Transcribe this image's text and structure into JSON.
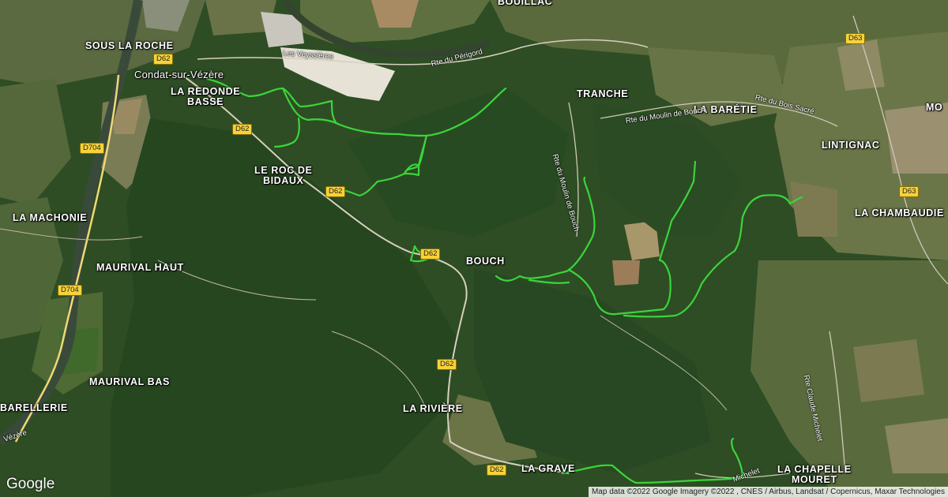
{
  "map": {
    "logo": "Google",
    "attribution": "Map data ©2022 Google Imagery ©2022 , CNES / Airbus, Landsat / Copernicus, Maxar Technologies",
    "route_color": "#3bd53b",
    "road_color": "#c9c2b5",
    "shield_color": "#f7d23a"
  },
  "places": {
    "sous_la_roche": "SOUS LA ROCHE",
    "condat": "Condat-sur-Vézère",
    "la_redonde_basse": "LA REDONDE\nBASSE",
    "le_roc_de_bidaux": "LE ROC DE\nBIDAUX",
    "la_machonie": "LA MACHONIE",
    "maurival_haut": "MAURIVAL HAUT",
    "maurival_bas": "MAURIVAL BAS",
    "barellerie": "BARELLERIE",
    "la_riviere": "LA RIVIÈRE",
    "la_grave": "LA GRAVE",
    "bouch": "BOUCH",
    "tranche": "TRANCHE",
    "la_baretie": "LA BARÉTIE",
    "lintignac": "LINTIGNAC",
    "la_chambaudie": "LA CHAMBAUDIE",
    "la_chapelle_mouret": "LA CHAPELLE\nMOURET",
    "bouillac": "BOUILLAC",
    "mo": "MO"
  },
  "streets": {
    "les_veyssieres": "Les Veyssières",
    "rte_du_perigord": "Rte du Périgord",
    "rte_du_moulin_de_bouch_vertical": "Rte du Moulin de Bouch",
    "rte_du_moulin_de_bouch": "Rte du Moulin de Bouch",
    "rte_du_bois_sacre": "Rte du Bois Sacré",
    "rte_claude_michelet": "Rte Claude Michelet",
    "michelet": "Michelet",
    "vezere": "Vézère"
  },
  "shields": {
    "d62_a": "D62",
    "d62_b": "D62",
    "d62_c": "D62",
    "d62_d": "D62",
    "d62_e": "D62",
    "d62_f": "D62",
    "d704_a": "D704",
    "d704_b": "D704",
    "d63_a": "D63",
    "d63_b": "D63"
  }
}
